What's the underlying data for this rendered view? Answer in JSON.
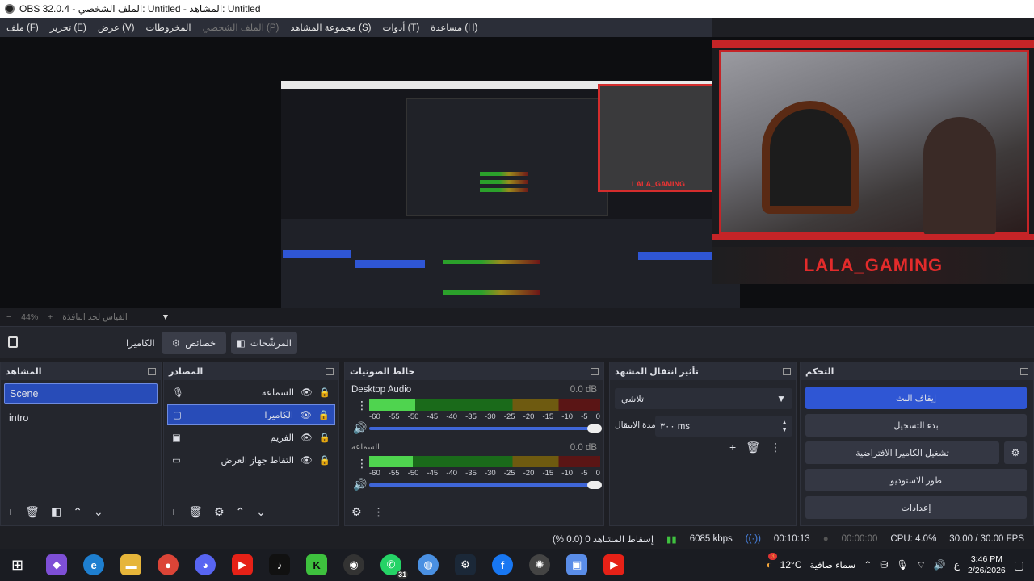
{
  "window": {
    "title": "OBS 32.0.4 - الملف الشخصي: Untitled - المشاهد: Untitled"
  },
  "menu": {
    "items": [
      "ملف (F)",
      "تحرير (E)",
      "عرض (V)",
      "المخروطات",
      "الملف الشخصي (P)",
      "مجموعة المشاهد (S)",
      "أدوات (T)",
      "مساعدة (H)"
    ]
  },
  "overlay": {
    "name": "LALA_GAMING",
    "mini_name": "LALA_GAMING"
  },
  "zoom": {
    "minus": "−",
    "value": "44%",
    "plus": "+",
    "fit": "القياس لحد النافذة"
  },
  "context": {
    "source": "الكاميرا",
    "properties": "خصائص",
    "filters": "المرشّحات"
  },
  "scenes": {
    "title": "المشاهد",
    "items": [
      "Scene",
      "intro"
    ]
  },
  "sources": {
    "title": "المصادر",
    "items": [
      "السماعه",
      "الكاميرا",
      "الفريم",
      "التقاط جهاز العرض"
    ]
  },
  "mixer": {
    "title": "خالط الصوتيات",
    "channels": [
      {
        "name": "Desktop Audio",
        "db": "0.0 dB",
        "level": 0.2
      },
      {
        "name": "السماعه",
        "db": "0.0 dB",
        "level": 0.19
      }
    ],
    "scale": [
      "-60",
      "-55",
      "-50",
      "-45",
      "-40",
      "-35",
      "-30",
      "-25",
      "-20",
      "-15",
      "-10",
      "-5",
      "0"
    ]
  },
  "transitions": {
    "title": "تأثير انتقال المشهد",
    "type": "تلاشي",
    "duration_label": "مدة الانتقال",
    "duration": "٣٠٠ ms"
  },
  "controls": {
    "title": "التحكم",
    "stop_stream": "إيقاف البث",
    "start_recording": "بدء التسجيل",
    "virtual_cam": "تشغيل الكاميرا الافتراضية",
    "studio_mode": "طور الاستوديو",
    "settings": "إعدادات"
  },
  "status": {
    "dropped": "إسقاط المشاهد 0 (0.0 %)",
    "bitrate": "6085 kbps",
    "stream_time": "00:10:13",
    "rec_time": "00:00:00",
    "cpu": "CPU: 4.0%",
    "fps": "30.00 / 30.00 FPS"
  },
  "taskbar": {
    "weather_temp": "12°C",
    "weather_text": "سماء صافية",
    "notif_count": "3",
    "lang": "ع",
    "time": "3:46 PM",
    "date": "2/26/2026",
    "whatsapp_badge": "31"
  }
}
